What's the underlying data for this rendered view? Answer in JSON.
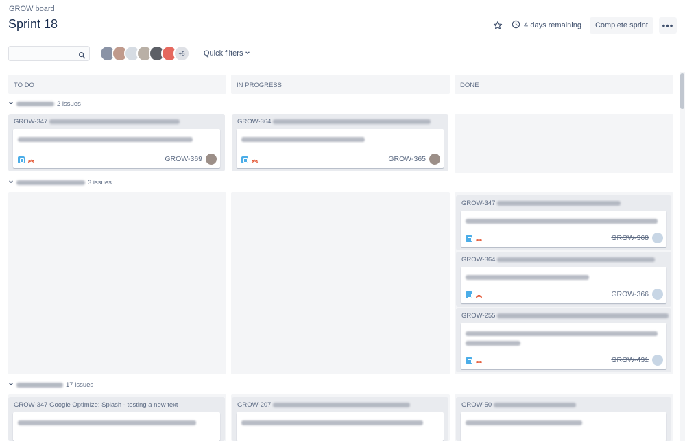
{
  "breadcrumb": "GROW board",
  "title": "Sprint 18",
  "header": {
    "remaining": "4 days remaining",
    "complete_sprint": "Complete sprint",
    "icons": [
      "star-icon",
      "clock-icon",
      "more-icon"
    ]
  },
  "filters": {
    "search_placeholder": "",
    "avatar_more": "+5",
    "quick_filters": "Quick filters"
  },
  "columns": [
    "TO DO",
    "IN PROGRESS",
    "DONE"
  ],
  "swimlanes": [
    {
      "count": "2 issues"
    },
    {
      "count": "3 issues"
    },
    {
      "count": "17 issues"
    }
  ],
  "cards": {
    "c1": {
      "parent": "GROW-347",
      "key": "GROW-369"
    },
    "c2": {
      "parent": "GROW-364",
      "key": "GROW-365"
    },
    "c3": {
      "parent": "GROW-347",
      "key": "GROW-368"
    },
    "c4": {
      "parent": "GROW-364",
      "key": "GROW-366"
    },
    "c5": {
      "parent": "GROW-255",
      "key": "GROW-431"
    },
    "c6": {
      "parent": "GROW-347 Google Optimize: Splash - testing a new text"
    },
    "c7": {
      "parent": "GROW-207"
    },
    "c8": {
      "parent": "GROW-50"
    }
  },
  "colors": {
    "accent": "#0052cc",
    "story": "#4bade8",
    "priority_high": "#de350b",
    "column_bg": "#f4f5f7"
  }
}
